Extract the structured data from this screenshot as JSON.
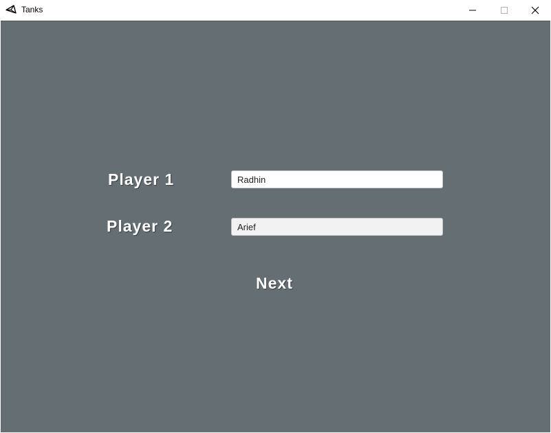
{
  "window": {
    "title": "Tanks",
    "icon": "unity-logo-icon",
    "controls": [
      "minimize-icon",
      "maximize-icon",
      "close-icon"
    ]
  },
  "form": {
    "player1_label": "Player 1",
    "player1_value": "Radhin",
    "player2_label": "Player 2",
    "player2_value": "Arief",
    "next_label": "Next"
  },
  "colors": {
    "background": "#656f73",
    "text": "#ffffff",
    "input_bg": "#ffffff",
    "input_bg_disabled": "#f2f2f2"
  }
}
